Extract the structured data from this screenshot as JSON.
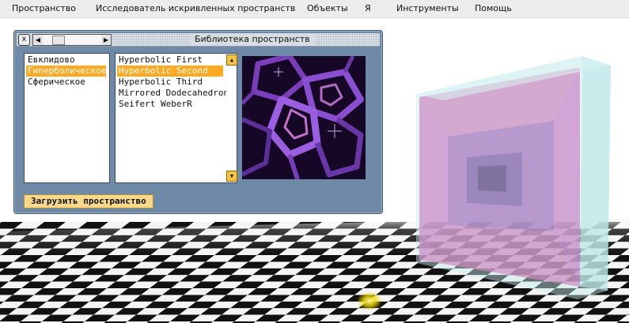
{
  "menu": {
    "items": [
      "Пространство",
      "Исследователь искривленных пространств",
      "Объекты",
      "Я",
      "Инструменты",
      "Помощь"
    ]
  },
  "dialog": {
    "title": "Библиотека пространств",
    "close_glyph": "x",
    "categories": [
      {
        "label": "Евклидово",
        "selected": false
      },
      {
        "label": "Гиперболическое",
        "selected": true
      },
      {
        "label": "Сферическое",
        "selected": false
      }
    ],
    "spaces": [
      {
        "label": "Hyperbolic First",
        "selected": false
      },
      {
        "label": "Hyperbolic Second",
        "selected": true
      },
      {
        "label": "Hyperbolic Third",
        "selected": false
      },
      {
        "label": "Mirrored Dodecahedron",
        "selected": false
      },
      {
        "label": "Seifert WeberR",
        "selected": false
      }
    ],
    "load_button": "Загрузить пространство"
  },
  "colors": {
    "selection": "#ffaa22",
    "window": "#6f8aa6",
    "button": "#f8d88a",
    "scrollbar_button": "#f5c242"
  }
}
